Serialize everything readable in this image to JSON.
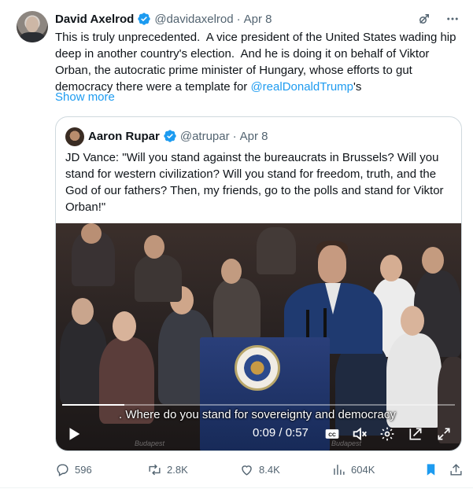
{
  "author": {
    "name": "David Axelrod",
    "handle": "@davidaxelrod",
    "separator": "·",
    "date": "Apr 8"
  },
  "tweet": {
    "text_before": "This is truly unprecedented.  A vice president of the United States wading hip deep in another country's election.  And he is doing it on behalf of Viktor Orban, the autocratic prime minister of Hungary, whose efforts to gut democracy there were a template for ",
    "mention": "@realDonaldTrump",
    "text_after": "'s",
    "show_more": "Show more"
  },
  "quote": {
    "name": "Aaron Rupar",
    "handle": "@atrupar",
    "separator": "·",
    "date": "Apr 8",
    "text": "JD Vance: \"Will you stand against the bureaucrats in Brussels? Will you stand for western civilization? Will you stand for freedom, truth, and the God of our fathers? Then, my friends, go to the polls and stand for Viktor Orban!\""
  },
  "video": {
    "caption": ". Where do you stand for sovereignty and democracy",
    "time": "0:09 / 0:57",
    "progress": 0.158,
    "watermark": "Budapest"
  },
  "actions": {
    "replies": "596",
    "reposts": "2.8K",
    "likes": "8.4K",
    "views": "604K"
  },
  "colors": {
    "accent": "#1d9bf0",
    "muted": "#536471",
    "border": "#cfd9de"
  },
  "icons": [
    "verified-badge-icon",
    "grok-icon",
    "more-icon",
    "play-icon",
    "captions-icon",
    "mute-icon",
    "settings-icon",
    "pip-icon",
    "fullscreen-icon",
    "reply-icon",
    "repost-icon",
    "like-icon",
    "views-icon",
    "bookmark-icon",
    "share-icon"
  ]
}
